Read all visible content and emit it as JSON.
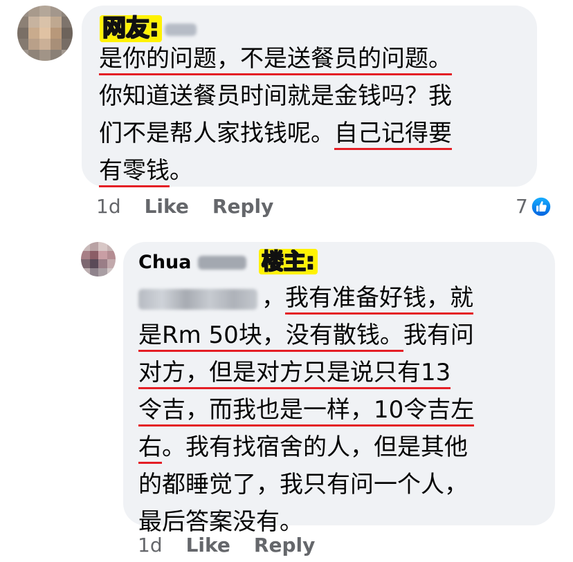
{
  "comment1": {
    "badge": "网友:",
    "lines": [
      "是你的问题，不是送餐员的问题。",
      "你知道送餐员时间就是金钱吗？我",
      "们不是帮人家找钱呢。",
      "自己记得要",
      "有零钱",
      "。"
    ],
    "time": "1d",
    "like_label": "Like",
    "reply_label": "Reply",
    "reaction_count": "7",
    "reaction_icon": "thumbs-up-icon"
  },
  "comment2": {
    "author": "Chua",
    "badge": "楼主:",
    "lines": [
      "，",
      "我有准备好钱，就",
      "是Rm 50块，没有散钱。",
      "我有问",
      "对方，但是对方只是说只有13",
      "令吉，而我也是一样，10令吉左",
      "右",
      "。我有找宿舍的人，但是其他",
      "的都睡觉了，我只有问一个人，",
      "最后答案没有。"
    ],
    "time": "1d",
    "like_label": "Like",
    "reply_label": "Reply"
  },
  "colors": {
    "bubble_bg": "#f0f2f5",
    "underline": "#e41e25",
    "badge_bg": "#fff200",
    "meta_text": "#65676b",
    "like_blue": "#1877f2"
  }
}
